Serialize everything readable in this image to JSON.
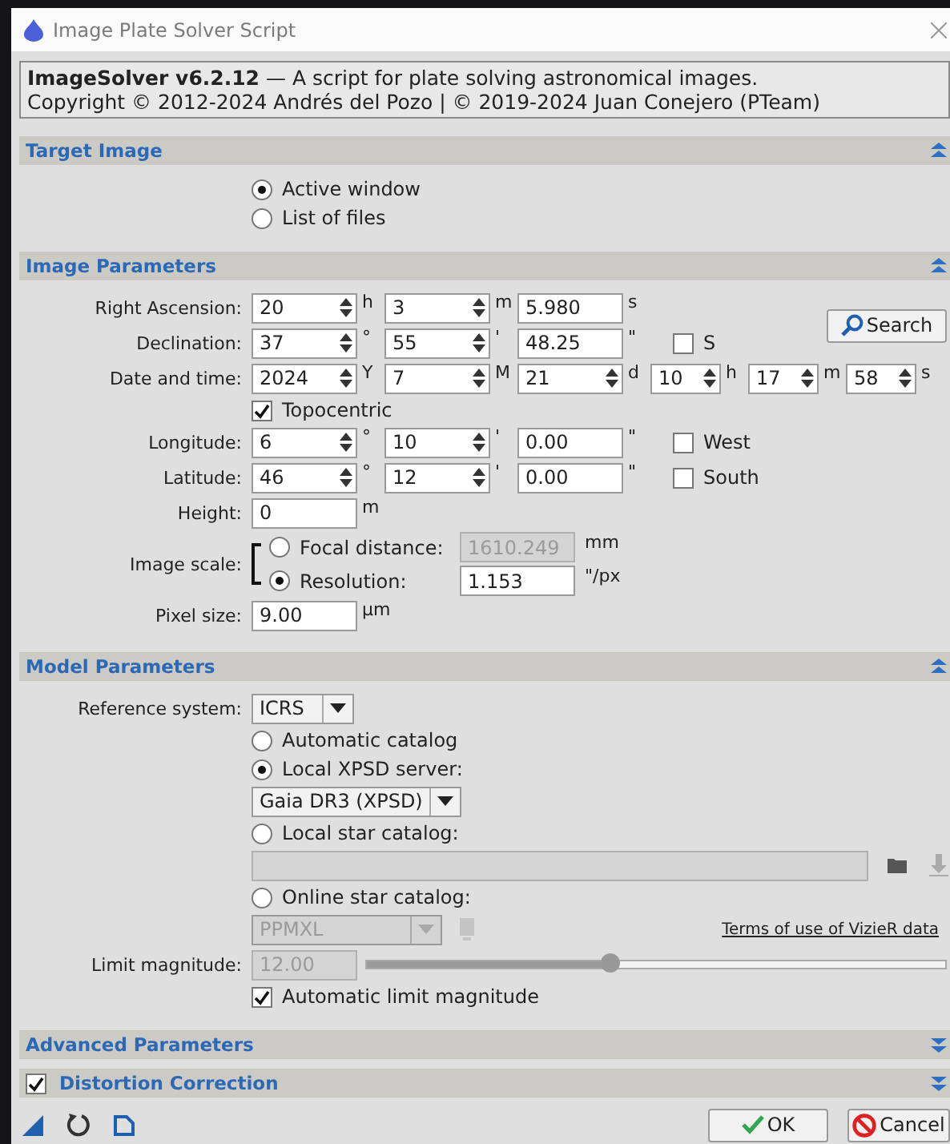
{
  "window": {
    "title": "Image Plate Solver Script"
  },
  "header": {
    "lines": [
      "**ImageSolver v6.2.12** — A script for plate solving astronomical images.",
      "Copyright © 2012-2024 Andrés del Pozo | © 2019-2024 Juan Conejero (PTeam)"
    ]
  },
  "sections": [
    {
      "title": "Target Image",
      "expanded": true,
      "rows": [
        {
          "kind": "radio",
          "label": "Active window",
          "selected": true
        },
        {
          "kind": "radio",
          "label": "List of files",
          "selected": false
        }
      ]
    },
    {
      "title": "Image Parameters",
      "expanded": true,
      "button": {
        "label": "Search"
      },
      "rows": [
        {
          "kind": "fields",
          "label": "Right Ascension:",
          "fields": [
            {
              "value": "20",
              "spin": true,
              "unit": "h"
            },
            {
              "value": "3",
              "spin": true,
              "unit": "m"
            },
            {
              "value": "5.980",
              "spin": false,
              "unit": "s"
            }
          ]
        },
        {
          "kind": "fields",
          "label": "Declination:",
          "fields": [
            {
              "value": "37",
              "spin": true,
              "unit": "°"
            },
            {
              "value": "55",
              "spin": true,
              "unit": "'"
            },
            {
              "value": "48.25",
              "spin": false,
              "unit": "\""
            }
          ],
          "check": {
            "label": "S",
            "checked": false
          }
        },
        {
          "kind": "fields",
          "label": "Date and time:",
          "fields": [
            {
              "value": "2024",
              "spin": true,
              "unit": "Y"
            },
            {
              "value": "7",
              "spin": true,
              "unit": "M"
            },
            {
              "value": "21",
              "spin": true,
              "unit": "d"
            },
            {
              "value": "10",
              "spin": true,
              "unit": "h"
            },
            {
              "value": "17",
              "spin": true,
              "unit": "m"
            },
            {
              "value": "58",
              "spin": true,
              "unit": "s"
            }
          ]
        },
        {
          "kind": "check",
          "label": "Topocentric",
          "checked": true
        },
        {
          "kind": "fields",
          "label": "Longitude:",
          "fields": [
            {
              "value": "6",
              "spin": true,
              "unit": "°"
            },
            {
              "value": "10",
              "spin": true,
              "unit": "'"
            },
            {
              "value": "0.00",
              "spin": false,
              "unit": "\""
            }
          ],
          "check": {
            "label": "West",
            "checked": false
          }
        },
        {
          "kind": "fields",
          "label": "Latitude:",
          "fields": [
            {
              "value": "46",
              "spin": true,
              "unit": "°"
            },
            {
              "value": "12",
              "spin": true,
              "unit": "'"
            },
            {
              "value": "0.00",
              "spin": false,
              "unit": "\""
            }
          ],
          "check": {
            "label": "South",
            "checked": false
          }
        },
        {
          "kind": "fields",
          "label": "Height:",
          "fields": [
            {
              "value": "0",
              "spin": false,
              "unit": "m"
            }
          ]
        },
        {
          "kind": "scale",
          "label": "Image scale:",
          "options": [
            {
              "label": "Focal distance:",
              "selected": false,
              "value": "1610.249",
              "disabled": true,
              "unit": "mm"
            },
            {
              "label": "Resolution:",
              "selected": true,
              "value": "1.153",
              "disabled": false,
              "unit": "\"/px"
            }
          ]
        },
        {
          "kind": "fields",
          "label": "Pixel size:",
          "fields": [
            {
              "value": "9.00",
              "spin": false,
              "unit": "µm"
            }
          ]
        }
      ]
    },
    {
      "title": "Model Parameters",
      "expanded": true,
      "rows": [
        {
          "kind": "combo",
          "label": "Reference system:",
          "value": "ICRS",
          "disabled": false
        },
        {
          "kind": "radio",
          "label": "Automatic catalog",
          "selected": false
        },
        {
          "kind": "radio",
          "label": "Local XPSD server:",
          "selected": true
        },
        {
          "kind": "combo",
          "value": "Gaia DR3 (XPSD)",
          "disabled": false
        },
        {
          "kind": "radio",
          "label": "Local star catalog:",
          "selected": false
        },
        {
          "kind": "file",
          "disabled": true
        },
        {
          "kind": "radio",
          "label": "Online star catalog:",
          "selected": false
        },
        {
          "kind": "online",
          "value": "PPMXL",
          "disabled": true,
          "link": "Terms of use of VizieR data"
        },
        {
          "kind": "slider",
          "label": "Limit magnitude:",
          "value": "12.00",
          "disabled": true,
          "level": 0.42
        },
        {
          "kind": "check",
          "label": "Automatic limit magnitude",
          "checked": true
        }
      ]
    },
    {
      "title": "Advanced Parameters",
      "expanded": false
    },
    {
      "title": "Distortion Correction",
      "expanded": false,
      "checked": true
    }
  ],
  "buttons": [
    {
      "kind": "ok",
      "label": "OK"
    },
    {
      "kind": "cancel",
      "label": "Cancel"
    }
  ]
}
